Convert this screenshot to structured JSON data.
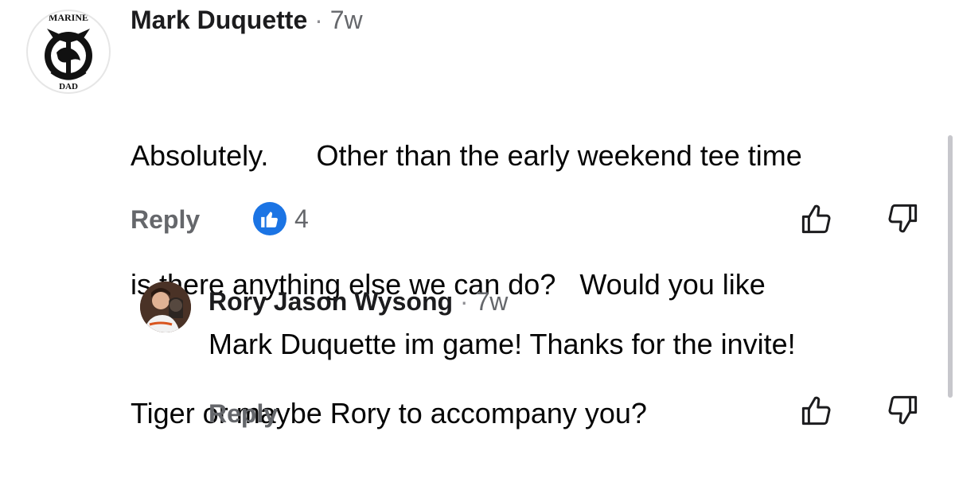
{
  "comment": {
    "author": "Mark Duquette",
    "separator": "·",
    "time": "7w",
    "avatar": {
      "name": "marine-dad-emblem",
      "top_text": "MARINE",
      "bottom_text": "DAD"
    },
    "lines": [
      "Absolutely.      Other than the early weekend tee time",
      "is there anything else we can do?   Would you like",
      "Tiger or maybe Rory to accompany you?"
    ],
    "reply_label": "Reply",
    "like_count": "4",
    "icons": {
      "like_badge": "thumbs-up-filled-icon",
      "upvote": "thumbs-up-outline-icon",
      "downvote": "thumbs-down-outline-icon"
    }
  },
  "reply": {
    "author": "Rory Jason Wysong",
    "separator": "·",
    "time": "7w",
    "text": "Mark Duquette im game! Thanks for the invite!",
    "reply_label": "Reply"
  },
  "colors": {
    "like_blue": "#1b74e4",
    "secondary_text": "#65676b"
  }
}
